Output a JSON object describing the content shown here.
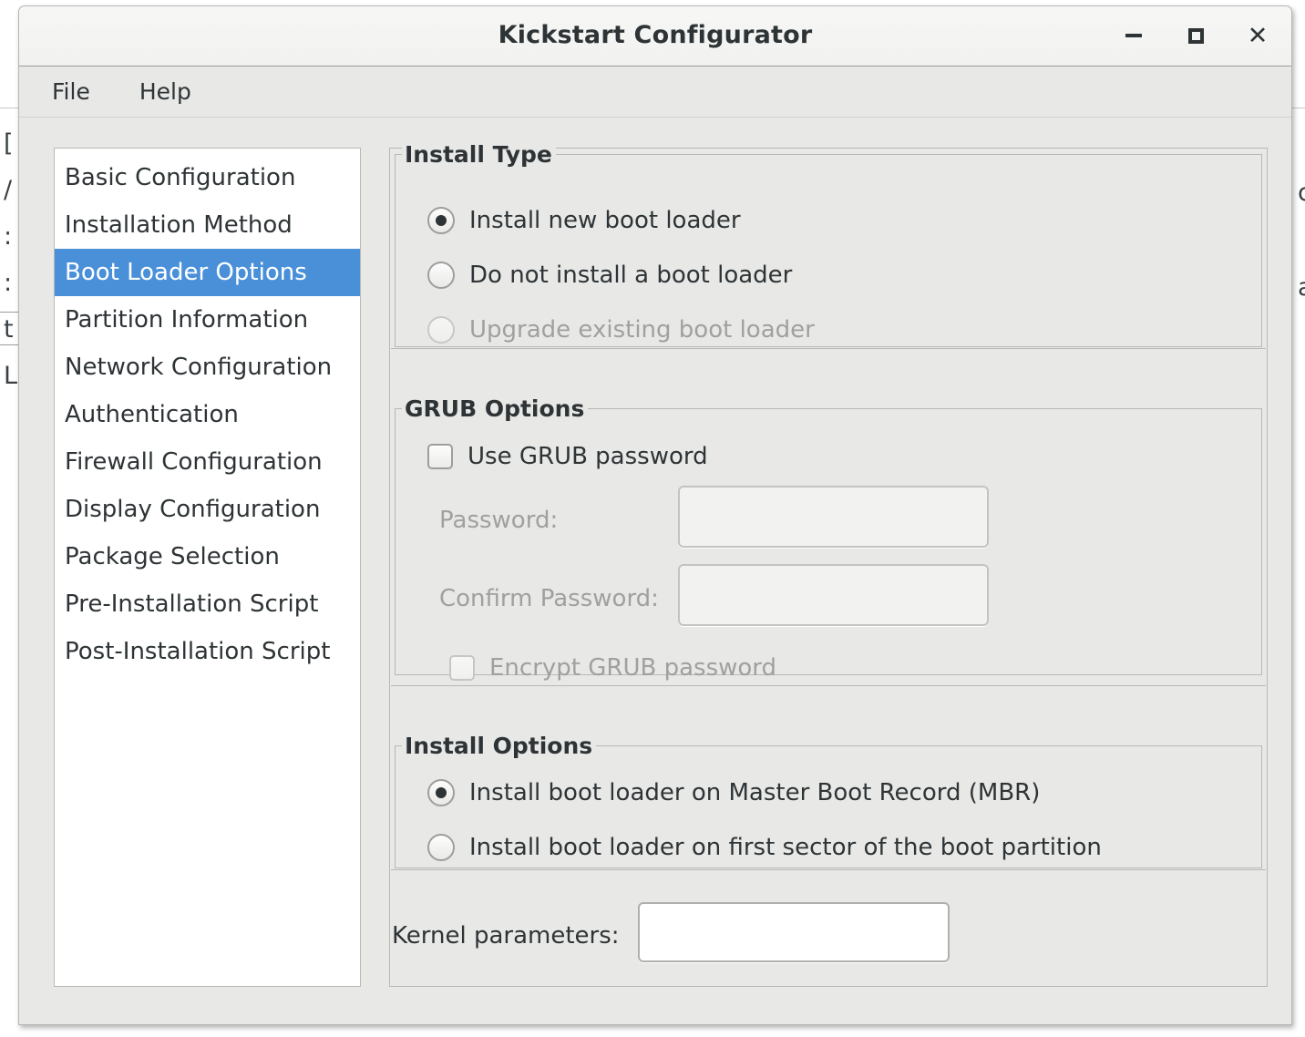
{
  "window": {
    "title": "Kickstart Configurator",
    "buttons": {
      "minimize": "minimize",
      "maximize": "maximize",
      "close": "✕"
    }
  },
  "menubar": {
    "items": [
      {
        "label": "File"
      },
      {
        "label": "Help"
      }
    ]
  },
  "sidebar": {
    "items": [
      {
        "label": "Basic Configuration",
        "selected": false
      },
      {
        "label": "Installation Method",
        "selected": false
      },
      {
        "label": "Boot Loader Options",
        "selected": true
      },
      {
        "label": "Partition Information",
        "selected": false
      },
      {
        "label": "Network Configuration",
        "selected": false
      },
      {
        "label": "Authentication",
        "selected": false
      },
      {
        "label": "Firewall Configuration",
        "selected": false
      },
      {
        "label": "Display Configuration",
        "selected": false
      },
      {
        "label": "Package Selection",
        "selected": false
      },
      {
        "label": "Pre-Installation Script",
        "selected": false
      },
      {
        "label": "Post-Installation Script",
        "selected": false
      }
    ]
  },
  "install_type": {
    "legend": "Install Type",
    "options": [
      {
        "label": "Install new boot loader",
        "checked": true,
        "disabled": false
      },
      {
        "label": "Do not install a boot loader",
        "checked": false,
        "disabled": false
      },
      {
        "label": "Upgrade existing boot loader",
        "checked": false,
        "disabled": true
      }
    ]
  },
  "grub_options": {
    "legend": "GRUB Options",
    "use_grub_password": {
      "label": "Use GRUB password",
      "checked": false,
      "disabled": false
    },
    "password": {
      "label": "Password:",
      "value": "",
      "disabled": true
    },
    "confirm_password": {
      "label": "Confirm Password:",
      "value": "",
      "disabled": true
    },
    "encrypt": {
      "label": "Encrypt GRUB password",
      "checked": false,
      "disabled": true
    }
  },
  "install_options": {
    "legend": "Install Options",
    "options": [
      {
        "label": "Install boot loader on Master Boot Record (MBR)",
        "checked": true,
        "disabled": false
      },
      {
        "label": "Install boot loader on first sector of the boot partition",
        "checked": false,
        "disabled": false
      }
    ],
    "kernel_parameters": {
      "label": "Kernel parameters:",
      "value": ""
    }
  },
  "background": {
    "left_fragments": "[\n/\n:\n:\nt\nL",
    "right_fragments": "c\na"
  },
  "colors": {
    "selection": "#4a90d9",
    "window_bg": "#e8e8e7",
    "text": "#2e3436",
    "disabled_text": "#a0a09d",
    "border": "#b8b8b5"
  }
}
